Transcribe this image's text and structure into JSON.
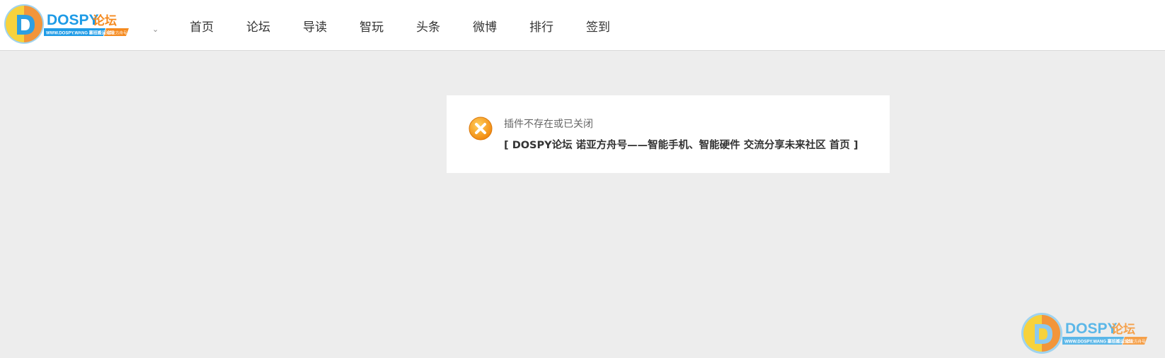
{
  "header": {
    "logo": {
      "brand": "DOSPY",
      "brand_cn": "论坛",
      "tagline_left": "WWW.DOSPY.WANG 塞班搬运论坛",
      "tagline_right": "诺亚方舟号"
    },
    "chevron": "⌄",
    "nav": [
      {
        "label": "首页"
      },
      {
        "label": "论坛"
      },
      {
        "label": "导读"
      },
      {
        "label": "智玩"
      },
      {
        "label": "头条"
      },
      {
        "label": "微博"
      },
      {
        "label": "排行"
      },
      {
        "label": "签到"
      }
    ]
  },
  "message": {
    "icon": "error-x-icon",
    "title": "插件不存在或已关闭",
    "link_open": "[ ",
    "link_text": "DOSPY论坛 诺亚方舟号——智能手机、智能硬件 交流分享未来社区 首页",
    "link_close": " ]"
  },
  "footer_logo": {
    "brand": "DOSPY",
    "brand_cn": "论坛",
    "tagline_left": "WWW.DOSPY.WANG 塞班搬运论坛",
    "tagline_right": "诺亚方舟号"
  },
  "colors": {
    "brand_blue": "#1e9be6",
    "brand_orange": "#f58a1f",
    "page_bg": "#ededed",
    "error_orange": "#f7941d"
  }
}
